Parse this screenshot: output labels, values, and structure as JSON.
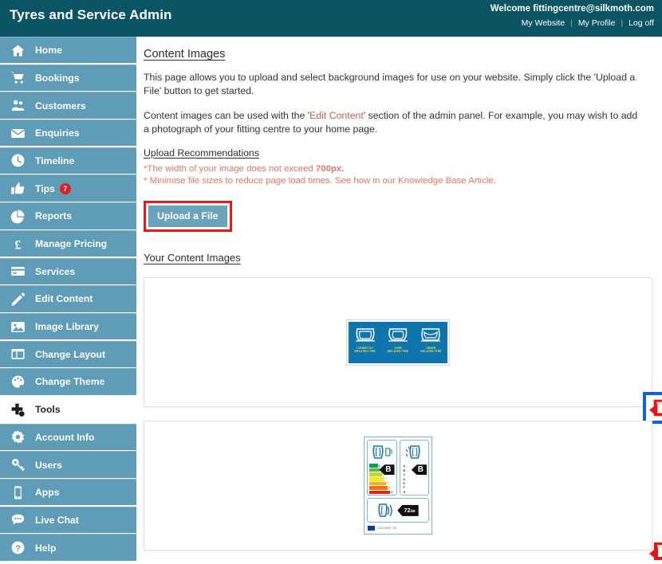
{
  "header": {
    "app_title": "Tyres and Service Admin",
    "welcome": "Welcome fittingcentre@silkmoth.com",
    "links": [
      {
        "label": "My Website"
      },
      {
        "label": "My Profile"
      },
      {
        "label": "Log off"
      }
    ],
    "separator": "|",
    "bg_color": "#0b5464"
  },
  "sidebar": {
    "bg_color": "#5e9cb7",
    "active_bg_color": "#ffffff",
    "items": [
      {
        "label": "Home",
        "icon": "home-icon",
        "active": false
      },
      {
        "label": "Bookings",
        "icon": "cart-icon",
        "active": false
      },
      {
        "label": "Customers",
        "icon": "users-icon",
        "active": false
      },
      {
        "label": "Enquiries",
        "icon": "envelope-icon",
        "active": false
      },
      {
        "label": "Timeline",
        "icon": "clock-icon",
        "active": false
      },
      {
        "label": "Tips",
        "icon": "thumbs-up-icon",
        "active": false,
        "badge": "7",
        "badge_color": "#e02020"
      },
      {
        "label": "Reports",
        "icon": "pie-chart-icon",
        "active": false
      },
      {
        "label": "Manage Pricing",
        "icon": "pound-icon",
        "active": false
      },
      {
        "label": "Services",
        "icon": "card-icon",
        "active": false
      },
      {
        "label": "Edit Content",
        "icon": "pencil-icon",
        "active": false
      },
      {
        "label": "Image Library",
        "icon": "image-icon",
        "active": false
      },
      {
        "label": "Change Layout",
        "icon": "layout-icon",
        "active": false
      },
      {
        "label": "Change Theme",
        "icon": "paint-icon",
        "active": false
      },
      {
        "label": "Tools",
        "icon": "tools-icon",
        "active": true
      },
      {
        "label": "Account Info",
        "icon": "gear-icon",
        "active": false
      },
      {
        "label": "Users",
        "icon": "key-icon",
        "active": false
      },
      {
        "label": "Apps",
        "icon": "mobile-icon",
        "active": false
      },
      {
        "label": "Live Chat",
        "icon": "chat-icon",
        "active": false
      },
      {
        "label": "Help",
        "icon": "question-icon",
        "active": false
      }
    ]
  },
  "main": {
    "page_title": "Content Images",
    "intro_paragraph_1": "This page allows you to upload and select background images for use on your website. Simply click the 'Upload a File' button to get started.",
    "intro_paragraph_2_before": "Content images can be used with the '",
    "intro_paragraph_2_link": "Edit Content",
    "intro_paragraph_2_after": "' section of the admin panel. For example, you may wish to add a photograph of your fitting centre to your home page.",
    "recommendations_title": "Upload Recommendations",
    "recommendation_1_text": "*The width of your image does not exceed ",
    "recommendation_1_bold": "700px.",
    "recommendation_2": "* Minimise file sizes to reduce page load times. See how in our Knowledge Base Article.",
    "recommendation_color": "#ef7564",
    "upload_button_label": "Upload a File",
    "upload_highlight_color": "#e8191b",
    "gallery_title": "Your Content Images"
  },
  "gallery": {
    "delete_icon_name": "delete-icon",
    "delete_icon_color": "#ee1111",
    "highlight_color": "#1560d8",
    "items": [
      {
        "name": "tyre-inflation-diagram",
        "type": "inflation-chart",
        "bg_color": "#0f76ad",
        "caption_color": "#f6e04d",
        "cells": [
          {
            "caption_line1": "CORRECTLY",
            "caption_line2": "INFLATED TYRE"
          },
          {
            "caption_line1": "OVER",
            "caption_line2": "INFLATED TYRE"
          },
          {
            "caption_line1": "UNDER",
            "caption_line2": "INFLATED TYRE"
          }
        ],
        "delete_highlighted": true
      },
      {
        "name": "eu-tyre-label",
        "type": "eu-tyre-label",
        "fuel_grade": "B",
        "wet_grip_grade": "B",
        "noise_value": "72",
        "noise_unit": "dB",
        "grade_letters": [
          "A",
          "B",
          "C",
          "D",
          "E",
          "F",
          "G"
        ],
        "regulation_text": "1222/2009 - B1",
        "delete_highlighted": false
      }
    ]
  }
}
